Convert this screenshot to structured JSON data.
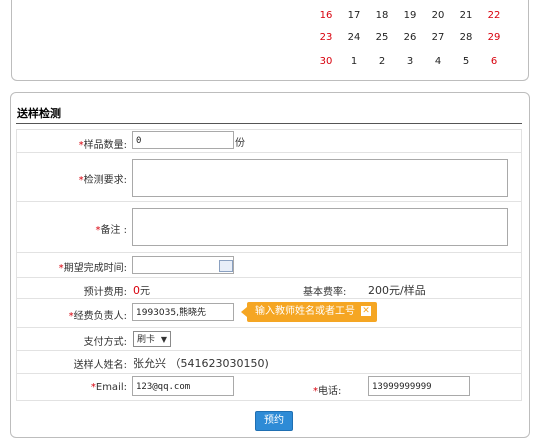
{
  "calendar": {
    "rows": [
      [
        "16",
        "17",
        "18",
        "19",
        "20",
        "21",
        "22"
      ],
      [
        "23",
        "24",
        "25",
        "26",
        "27",
        "28",
        "29"
      ],
      [
        "30",
        "1",
        "2",
        "3",
        "4",
        "5",
        "6"
      ]
    ]
  },
  "form": {
    "title": "送样检测",
    "sample_qty": {
      "label": "样品数量:",
      "value": "0",
      "unit": "份"
    },
    "test_req": {
      "label": "检测要求:"
    },
    "remark": {
      "label": "备注 :"
    },
    "expected_time": {
      "label": "期望完成时间:"
    },
    "est_fee": {
      "label": "预计费用:",
      "value": "0",
      "unit": "元"
    },
    "base_rate": {
      "label": "基本费率:",
      "value": "200元/样品"
    },
    "payer": {
      "label": "经费负责人:",
      "value": "1993035,熊晓先",
      "tooltip": "输入教师姓名或者工号"
    },
    "payment": {
      "label": "支付方式:",
      "selected": "刷卡"
    },
    "sender": {
      "label": "送样人姓名:",
      "value": "张允兴 （541623030150)"
    },
    "email": {
      "label": "Email:",
      "value": "123@qq.com"
    },
    "phone": {
      "label": "电话:",
      "value": "13999999999"
    },
    "submit_label": "预约",
    "required_mark": "*"
  },
  "colors": {
    "required": "#d8000c",
    "tooltip": "#f5a623",
    "button": "#2e8bd6"
  }
}
